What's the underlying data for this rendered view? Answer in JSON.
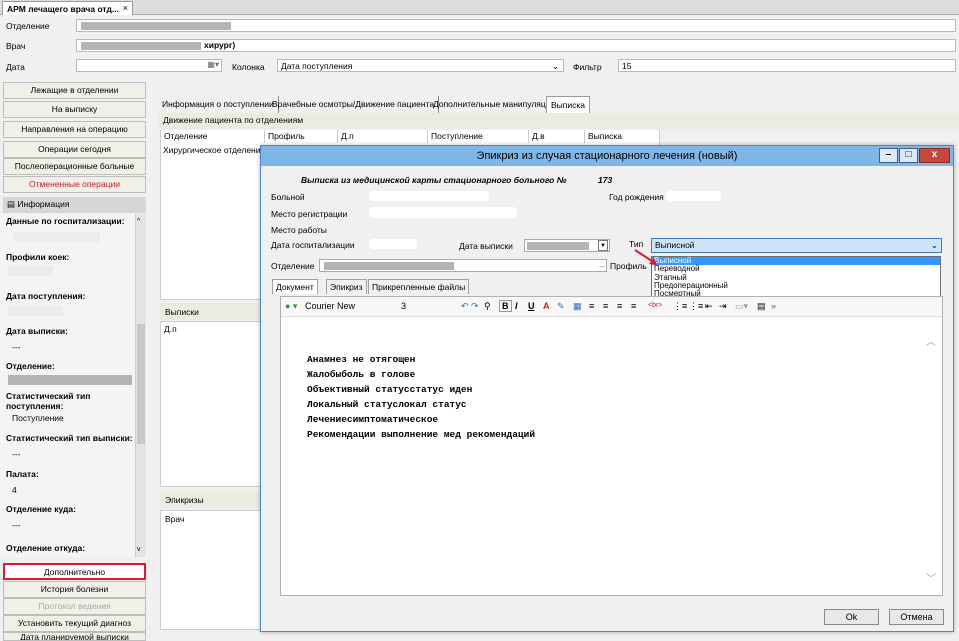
{
  "window_tab": {
    "title": "АРМ лечащего врача отд...",
    "close": "×"
  },
  "filter_bar": {
    "department_label": "Отделение",
    "doctor_label": "Врач",
    "doctor_value_suffix": "хирург)",
    "date_label": "Дата",
    "column_label": "Колонка",
    "column_value": "Дата поступления",
    "filter_label": "Фильтр",
    "filter_value": "15"
  },
  "left_nav": {
    "items": [
      {
        "label": "Лежащие в отделении",
        "state": "normal"
      },
      {
        "label": "На выписку",
        "state": "normal"
      },
      {
        "label": "Направления на операцию",
        "state": "normal"
      },
      {
        "label": "Операции сегодня",
        "state": "normal"
      },
      {
        "label": "Послеоперационные больные",
        "state": "normal"
      },
      {
        "label": "Отмененные операции",
        "state": "red"
      }
    ],
    "info_header": "Информация",
    "bottom_items": [
      {
        "label": "Дополнительно",
        "state": "highlighted"
      },
      {
        "label": "История болезни",
        "state": "normal"
      },
      {
        "label": "Протокол ведения",
        "state": "disabled"
      },
      {
        "label": "Установить текущий диагноз",
        "state": "normal"
      },
      {
        "label": "Дата планируемой выписки",
        "state": "normal"
      }
    ]
  },
  "info_panel": {
    "hosp_data": "Данные по госпитализации:",
    "bed_profiles": "Профили коек:",
    "admission_date": "Дата поступления:",
    "discharge_date": "Дата выписки:",
    "discharge_date_value": "---",
    "department": "Отделение:",
    "stat_admission_type": "Статистический тип поступления:",
    "stat_admission_value": "Поступление",
    "stat_discharge_type": "Статистический тип выписки:",
    "stat_discharge_value": "---",
    "ward": "Палата:",
    "ward_value": "4",
    "dept_to": "Отделение куда:",
    "dept_to_value": "---",
    "dept_from": "Отделение откуда:"
  },
  "main_tabs": [
    "Информация о поступлении",
    "Врачебные осмотры/Движение пациента",
    "Дополнительные манипуляции",
    "Выписка"
  ],
  "movement": {
    "title": "Движение пациента по отделениям",
    "columns": [
      "Отделение",
      "Профиль",
      "Д.п",
      "Поступление",
      "Д.в",
      "Выписка"
    ],
    "rows": [
      [
        "Хирургическое отделение"
      ]
    ]
  },
  "discharges_section": {
    "title": "Выписки",
    "column": "Д.п"
  },
  "epicrisis_section": {
    "title": "Эпикризы",
    "column": "Врач"
  },
  "dialog": {
    "title": "Эпикриз из случая стационарного лечения (новый)",
    "heading": "Выписка из медицинской карты стационарного больного №",
    "number": "173",
    "patient_label": "Больной",
    "birth_year_label": "Год рождения",
    "reg_place_label": "Место регистрации",
    "work_place_label": "Место работы",
    "hosp_date_label": "Дата госпитализации",
    "discharge_date_label": "Дата выписки",
    "type_label": "Тип",
    "type_value": "Выписной",
    "department_label": "Отделение",
    "profile_label": "Профиль",
    "type_options": [
      "Выписной",
      "Переводной",
      "Этапный",
      "Предоперационный",
      "Посмертный"
    ],
    "type_selected_index": 0,
    "tabs": [
      "Документ",
      "Эпикриз",
      "Прикрепленные файлы"
    ],
    "toolbar": {
      "font": "Courier New",
      "size": "3"
    },
    "text_lines": [
      "Анамнез  не отягощен",
      "Жалобыболь в голове",
      "Объективный статусстатус иден",
      "Локальный статуслокал статус",
      "Лечениесимптоматическое",
      "Рекомендации выполнение мед рекомендаций"
    ],
    "ok_label": "Ok",
    "cancel_label": "Отмена"
  },
  "colors": {
    "title_bar": "#7fb6e8",
    "highlight": "#e0182a",
    "selection": "#3399ff"
  }
}
